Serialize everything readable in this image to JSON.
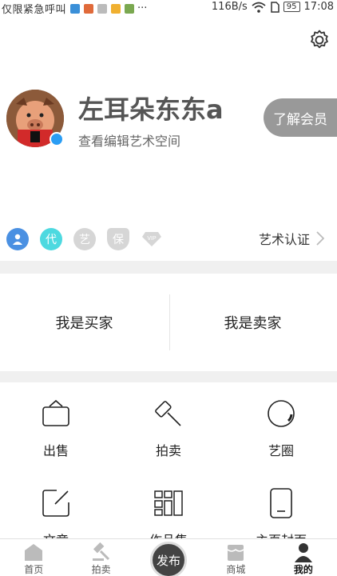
{
  "status_bar": {
    "carrier_text": "仅限紧急呼叫",
    "speed": "116B/s",
    "battery": "95",
    "time": "17:08"
  },
  "profile": {
    "username": "左耳朵东东a",
    "subtitle": "查看编辑艺术空间",
    "member_button": "了解会员",
    "avatar_icon": "pig-avatar-image",
    "badges": [
      {
        "name": "user-badge-icon",
        "text": ""
      },
      {
        "name": "dai-badge-icon",
        "text": "代"
      },
      {
        "name": "yi-badge-icon",
        "text": "艺"
      },
      {
        "name": "bao-badge-icon",
        "text": "保"
      },
      {
        "name": "vip-badge-icon",
        "text": "VIP"
      }
    ],
    "art_cert_label": "艺术认证"
  },
  "roles": {
    "buyer_label": "我是买家",
    "seller_label": "我是卖家"
  },
  "grid": [
    {
      "label": "出售",
      "icon": "basket-icon"
    },
    {
      "label": "拍卖",
      "icon": "gavel-icon"
    },
    {
      "label": "艺圈",
      "icon": "circle-icon"
    },
    {
      "label": "文章",
      "icon": "edit-icon"
    },
    {
      "label": "作品集",
      "icon": "collection-icon"
    },
    {
      "label": "主页封面",
      "icon": "phone-cover-icon"
    }
  ],
  "tabbar": {
    "home": "首页",
    "auction": "拍卖",
    "publish": "发布",
    "mall": "商城",
    "mine": "我的"
  },
  "colors": {
    "member_button_bg": "#999999",
    "badge_user": "#4a90e2",
    "badge_dai": "#4dd9e0",
    "badge_inactive": "#d6d6d6",
    "band_gray": "#f0f0f0",
    "publish_bg": "#444444"
  }
}
